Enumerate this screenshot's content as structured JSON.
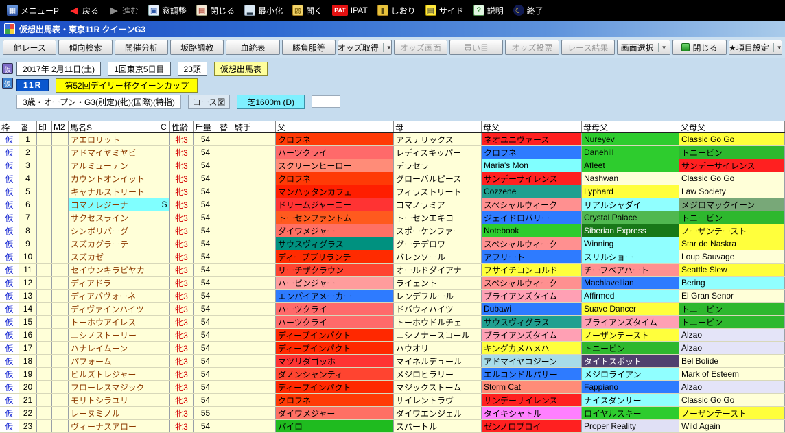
{
  "titlebar": {
    "title": "仮想出馬表・東京11R クイーンG3"
  },
  "toolbar": {
    "items": [
      {
        "label": "メニューP",
        "icon": "menu-icon"
      },
      {
        "label": "戻る",
        "icon": "back-icon"
      },
      {
        "label": "進む",
        "icon": "forward-icon"
      },
      {
        "label": "窓調整",
        "icon": "window-adjust-icon"
      },
      {
        "label": "閉じる",
        "icon": "close-window-icon"
      },
      {
        "label": "最小化",
        "icon": "minimize-icon"
      },
      {
        "label": "開く",
        "icon": "open-icon"
      },
      {
        "label": "IPAT",
        "icon": "pat-icon",
        "badge": "PAT"
      },
      {
        "label": "しおり",
        "icon": "bookmark-icon"
      },
      {
        "label": "サイド",
        "icon": "side-icon"
      },
      {
        "label": "説明",
        "icon": "help-icon"
      },
      {
        "label": "終了",
        "icon": "exit-icon"
      }
    ]
  },
  "menubar": {
    "buttons": [
      {
        "label": "他レース"
      },
      {
        "label": "傾向検索"
      },
      {
        "label": "開催分析"
      },
      {
        "label": "坂路調教"
      },
      {
        "label": "血統表"
      },
      {
        "label": "勝負服等"
      },
      {
        "label": "オッズ取得",
        "dropdown": true
      },
      {
        "label": "オッズ画面",
        "disabled": true
      },
      {
        "label": "買い目",
        "disabled": true
      },
      {
        "label": "オッズ投票",
        "disabled": true
      },
      {
        "label": "レース結果",
        "disabled": true
      },
      {
        "label": "画面選択",
        "dropdown": true
      },
      {
        "label": "閉じる",
        "icon": "green-close-icon"
      },
      {
        "label": "★項目設定",
        "dropdown": true
      }
    ]
  },
  "race_info": {
    "date": "2017年 2月11日(土)",
    "meeting": "1回東京5日目",
    "heads": "23頭",
    "sheet_label": "仮想出馬表",
    "race_no": "11R",
    "race_name": "第52回デイリー杯クイーンカップ",
    "conditions": "3歳・オープン・G3(別定)(牝)(国際)(特指)",
    "course_map_label": "コース図",
    "course": "芝1600m (D)"
  },
  "table": {
    "headers": [
      "枠",
      "番",
      "印",
      "M2",
      "馬名S",
      "C",
      "性齢",
      "斤量",
      "替",
      "騎手",
      "父",
      "母",
      "母父",
      "母母父",
      "父母父"
    ],
    "rows": [
      {
        "waku": "仮",
        "num": "1",
        "name": "アエロリット",
        "c": "",
        "sex": "牝3",
        "wt": "54",
        "jockey": "",
        "sire": [
          "クロフネ",
          "#FF3A06",
          ""
        ],
        "dam": [
          "アステリックス",
          "",
          ""
        ],
        "damsire": [
          "ネオユニヴァース",
          "#FF2020",
          ""
        ],
        "dds": [
          "Nureyev",
          "#2ECC2E",
          ""
        ],
        "sds": [
          "Classic Go Go",
          "#FFFF3C",
          ""
        ]
      },
      {
        "waku": "仮",
        "num": "2",
        "name": "アドマイヤミヤビ",
        "c": "",
        "sex": "牝3",
        "wt": "54",
        "jockey": "",
        "sire": [
          "ハーツクライ",
          "#FF6A6A",
          ""
        ],
        "dam": [
          "レディスキッパー",
          "",
          ""
        ],
        "damsire": [
          "クロフネ",
          "#2E7BFF",
          ""
        ],
        "dds": [
          "Danehill",
          "#2ECC2E",
          ""
        ],
        "sds": [
          "トニービン",
          "#2EB82E",
          ""
        ]
      },
      {
        "waku": "仮",
        "num": "3",
        "name": "アルミューテン",
        "c": "",
        "sex": "牝3",
        "wt": "54",
        "jockey": "",
        "sire": [
          "スクリーンヒーロー",
          "#FF8C78",
          ""
        ],
        "dam": [
          "デラセラ",
          "",
          ""
        ],
        "damsire": [
          "Maria's Mon",
          "#80FFFF",
          ""
        ],
        "dds": [
          "Afleet",
          "#2ECC2E",
          ""
        ],
        "sds": [
          "サンデーサイレンス",
          "#FF2020",
          ""
        ]
      },
      {
        "waku": "仮",
        "num": "4",
        "name": "カウントオンイット",
        "c": "",
        "sex": "牝3",
        "wt": "54",
        "jockey": "",
        "sire": [
          "クロフネ",
          "#FF3A06",
          ""
        ],
        "dam": [
          "グローバルピース",
          "",
          ""
        ],
        "damsire": [
          "サンデーサイレンス",
          "#FF2020",
          ""
        ],
        "dds": [
          "Nashwan",
          "",
          ""
        ],
        "sds": [
          "Classic Go Go",
          "",
          ""
        ]
      },
      {
        "waku": "仮",
        "num": "5",
        "name": "キャナルストリート",
        "c": "",
        "sex": "牝3",
        "wt": "54",
        "jockey": "",
        "sire": [
          "マンハッタンカフェ",
          "#FF1E00",
          ""
        ],
        "dam": [
          "フィラストリート",
          "",
          ""
        ],
        "damsire": [
          "Cozzene",
          "#20A090",
          ""
        ],
        "dds": [
          "Lyphard",
          "#FFFF3C",
          ""
        ],
        "sds": [
          "Law Society",
          "",
          ""
        ]
      },
      {
        "waku": "仮",
        "num": "6",
        "name": "コマノレジーナ",
        "name_bg": "#80FFFF",
        "c": "S",
        "c_bg": "#80FFFF",
        "sex": "牝3",
        "wt": "54",
        "jockey": "",
        "sire": [
          "ドリームジャーニー",
          "#FF3333",
          ""
        ],
        "dam": [
          "コマノラミア",
          "",
          ""
        ],
        "damsire": [
          "スペシャルウィーク",
          "#FF9090",
          ""
        ],
        "dds": [
          "リアルシャダイ",
          "#90FFFF",
          ""
        ],
        "sds": [
          "メジロマックイーン",
          "#78A878",
          ""
        ]
      },
      {
        "waku": "仮",
        "num": "7",
        "name": "サクセスライン",
        "c": "",
        "sex": "牝3",
        "wt": "54",
        "jockey": "",
        "sire": [
          "トーセンファントム",
          "#FF5A1E",
          ""
        ],
        "dam": [
          "トーセンエキコ",
          "",
          ""
        ],
        "damsire": [
          "ジェイドロバリー",
          "#2E7BFF",
          ""
        ],
        "dds": [
          "Crystal Palace",
          "#50B850",
          ""
        ],
        "sds": [
          "トニービン",
          "#2EB82E",
          ""
        ]
      },
      {
        "waku": "仮",
        "num": "8",
        "name": "シンボリバーグ",
        "c": "",
        "sex": "牝3",
        "wt": "54",
        "jockey": "",
        "sire": [
          "ダイワメジャー",
          "#FF7064",
          ""
        ],
        "dam": [
          "スポーケンファー",
          "",
          ""
        ],
        "damsire": [
          "Notebook",
          "#2ECC2E",
          ""
        ],
        "dds": [
          "Siberian Express",
          "#187818",
          "#FFFFFF"
        ],
        "sds": [
          "ノーザンテースト",
          "#FFFF3C",
          ""
        ]
      },
      {
        "waku": "仮",
        "num": "9",
        "name": "スズカグラーテ",
        "c": "",
        "sex": "牝3",
        "wt": "54",
        "jockey": "",
        "sire": [
          "サウスヴィグラス",
          "#00917F",
          ""
        ],
        "dam": [
          "グーテデロワ",
          "",
          ""
        ],
        "damsire": [
          "スペシャルウィーク",
          "#FF9090",
          ""
        ],
        "dds": [
          "Winning",
          "#90FFFF",
          ""
        ],
        "sds": [
          "Star de Naskra",
          "#FFFF3C",
          ""
        ]
      },
      {
        "waku": "仮",
        "num": "10",
        "name": "スズカゼ",
        "c": "",
        "sex": "牝3",
        "wt": "54",
        "jockey": "",
        "sire": [
          "ディープブリランテ",
          "#FF2B00",
          ""
        ],
        "dam": [
          "バレンソール",
          "",
          ""
        ],
        "damsire": [
          "アフリート",
          "#2E7BFF",
          ""
        ],
        "dds": [
          "スリルショー",
          "#90FFFF",
          ""
        ],
        "sds": [
          "Loup Sauvage",
          "",
          ""
        ]
      },
      {
        "waku": "仮",
        "num": "11",
        "name": "セイウンキラビヤカ",
        "c": "",
        "sex": "牝3",
        "wt": "54",
        "jockey": "",
        "sire": [
          "リーチザクラウン",
          "#FF4430",
          ""
        ],
        "dam": [
          "オールドダイアナ",
          "",
          ""
        ],
        "damsire": [
          "フサイチコンコルド",
          "#FFFF3C",
          ""
        ],
        "dds": [
          "チーフベアハート",
          "#FF9090",
          ""
        ],
        "sds": [
          "Seattle Slew",
          "#FFFF3C",
          ""
        ]
      },
      {
        "waku": "仮",
        "num": "12",
        "name": "ディアドラ",
        "c": "",
        "sex": "牝3",
        "wt": "54",
        "jockey": "",
        "sire": [
          "ハービンジャー",
          "#FF9C9C",
          ""
        ],
        "dam": [
          "ライェント",
          "",
          ""
        ],
        "damsire": [
          "スペシャルウィーク",
          "#FF9090",
          ""
        ],
        "dds": [
          "Machiavellian",
          "#2E7BFF",
          ""
        ],
        "sds": [
          "Bering",
          "#90FFFF",
          ""
        ]
      },
      {
        "waku": "仮",
        "num": "13",
        "name": "ディアパヴォーネ",
        "c": "",
        "sex": "牝3",
        "wt": "54",
        "jockey": "",
        "sire": [
          "エンパイアメーカー",
          "#2E7BFF",
          ""
        ],
        "dam": [
          "レンデフルール",
          "",
          ""
        ],
        "damsire": [
          "ブライアンズタイム",
          "#FFA0B4",
          ""
        ],
        "dds": [
          "Affirmed",
          "#90FFFF",
          ""
        ],
        "sds": [
          "El Gran Senor",
          "",
          ""
        ]
      },
      {
        "waku": "仮",
        "num": "14",
        "name": "ディヴァインハイツ",
        "c": "",
        "sex": "牝3",
        "wt": "54",
        "jockey": "",
        "sire": [
          "ハーツクライ",
          "#FF6A6A",
          ""
        ],
        "dam": [
          "ドバウィハイツ",
          "",
          ""
        ],
        "damsire": [
          "Dubawi",
          "#2E7BFF",
          ""
        ],
        "dds": [
          "Suave Dancer",
          "#FFFF3C",
          ""
        ],
        "sds": [
          "トニービン",
          "#2EB82E",
          ""
        ]
      },
      {
        "waku": "仮",
        "num": "15",
        "name": "トーホウアイレス",
        "c": "",
        "sex": "牝3",
        "wt": "54",
        "jockey": "",
        "sire": [
          "ハーツクライ",
          "#FF6A6A",
          ""
        ],
        "dam": [
          "トーホウドルチェ",
          "",
          ""
        ],
        "damsire": [
          "サウスヴィグラス",
          "#20A090",
          ""
        ],
        "dds": [
          "ブライアンズタイム",
          "#FFA0B4",
          ""
        ],
        "sds": [
          "トニービン",
          "#2EB82E",
          ""
        ]
      },
      {
        "waku": "仮",
        "num": "16",
        "name": "ニシノストーリー",
        "c": "",
        "sex": "牝3",
        "wt": "54",
        "jockey": "",
        "sire": [
          "ディープインパクト",
          "#FF2800",
          ""
        ],
        "dam": [
          "ニシノナースコール",
          "",
          ""
        ],
        "damsire": [
          "ブライアンズタイム",
          "#FFA0B4",
          ""
        ],
        "dds": [
          "ノーザンテースト",
          "#FFFF3C",
          ""
        ],
        "sds": [
          "Alzao",
          "#E4E4F8",
          ""
        ]
      },
      {
        "waku": "仮",
        "num": "17",
        "name": "ハナレイムーン",
        "c": "",
        "sex": "牝3",
        "wt": "54",
        "jockey": "",
        "sire": [
          "ディープインパクト",
          "#FF2800",
          ""
        ],
        "dam": [
          "ハウオリ",
          "",
          ""
        ],
        "damsire": [
          "キングカメハメハ",
          "#FFFF3C",
          ""
        ],
        "dds": [
          "トニービン",
          "#2EB82E",
          ""
        ],
        "sds": [
          "Alzao",
          "#E4E4F8",
          ""
        ]
      },
      {
        "waku": "仮",
        "num": "18",
        "name": "パフォーム",
        "c": "",
        "sex": "牝3",
        "wt": "54",
        "jockey": "",
        "sire": [
          "マツリダゴッホ",
          "#FF3333",
          ""
        ],
        "dam": [
          "マイネルデュール",
          "",
          ""
        ],
        "damsire": [
          "アドマイヤコジーン",
          "#A8DCE8",
          ""
        ],
        "dds": [
          "タイトスポット",
          "#50416E",
          "#FFFFFF"
        ],
        "sds": [
          "Bel Bolide",
          "",
          ""
        ]
      },
      {
        "waku": "仮",
        "num": "19",
        "name": "ビルズトレジャー",
        "c": "",
        "sex": "牝3",
        "wt": "54",
        "jockey": "",
        "sire": [
          "ダノンシャンティ",
          "#FF4430",
          ""
        ],
        "dam": [
          "メジロヒラリー",
          "",
          ""
        ],
        "damsire": [
          "エルコンドルパサー",
          "#2E7BFF",
          ""
        ],
        "dds": [
          "メジロライアン",
          "#90FFFF",
          ""
        ],
        "sds": [
          "Mark of Esteem",
          "",
          ""
        ]
      },
      {
        "waku": "仮",
        "num": "20",
        "name": "フローレスマジック",
        "c": "",
        "sex": "牝3",
        "wt": "54",
        "jockey": "",
        "sire": [
          "ディープインパクト",
          "#FF2800",
          ""
        ],
        "dam": [
          "マジックストーム",
          "",
          ""
        ],
        "damsire": [
          "Storm Cat",
          "#FF8C78",
          ""
        ],
        "dds": [
          "Fappiano",
          "#2E7BFF",
          ""
        ],
        "sds": [
          "Alzao",
          "#E4E4F8",
          ""
        ]
      },
      {
        "waku": "仮",
        "num": "21",
        "name": "モリトシラユリ",
        "c": "",
        "sex": "牝3",
        "wt": "54",
        "jockey": "",
        "sire": [
          "クロフネ",
          "#FF3A06",
          ""
        ],
        "dam": [
          "サイレントラヴ",
          "",
          ""
        ],
        "damsire": [
          "サンデーサイレンス",
          "#FF2020",
          ""
        ],
        "dds": [
          "ナイスダンサー",
          "#90FFFF",
          ""
        ],
        "sds": [
          "Classic Go Go",
          "",
          ""
        ]
      },
      {
        "waku": "仮",
        "num": "22",
        "name": "レーヌミノル",
        "c": "",
        "sex": "牝3",
        "wt": "55",
        "jockey": "",
        "sire": [
          "ダイワメジャー",
          "#FF7064",
          ""
        ],
        "dam": [
          "ダイワエンジェル",
          "",
          ""
        ],
        "damsire": [
          "タイキシャトル",
          "#FF80FF",
          ""
        ],
        "dds": [
          "ロイヤルスキー",
          "#2ECC2E",
          ""
        ],
        "sds": [
          "ノーザンテースト",
          "#FFFF3C",
          ""
        ]
      },
      {
        "waku": "仮",
        "num": "23",
        "name": "ヴィーナスアロー",
        "c": "",
        "sex": "牝3",
        "wt": "54",
        "jockey": "",
        "sire": [
          "パイロ",
          "#1FBB1F",
          ""
        ],
        "dam": [
          "スパートル",
          "",
          ""
        ],
        "damsire": [
          "ゼンノロブロイ",
          "#FF2020",
          ""
        ],
        "dds": [
          "Proper Reality",
          "#E0E0F5",
          ""
        ],
        "sds": [
          "Wild Again",
          "",
          ""
        ]
      }
    ]
  }
}
